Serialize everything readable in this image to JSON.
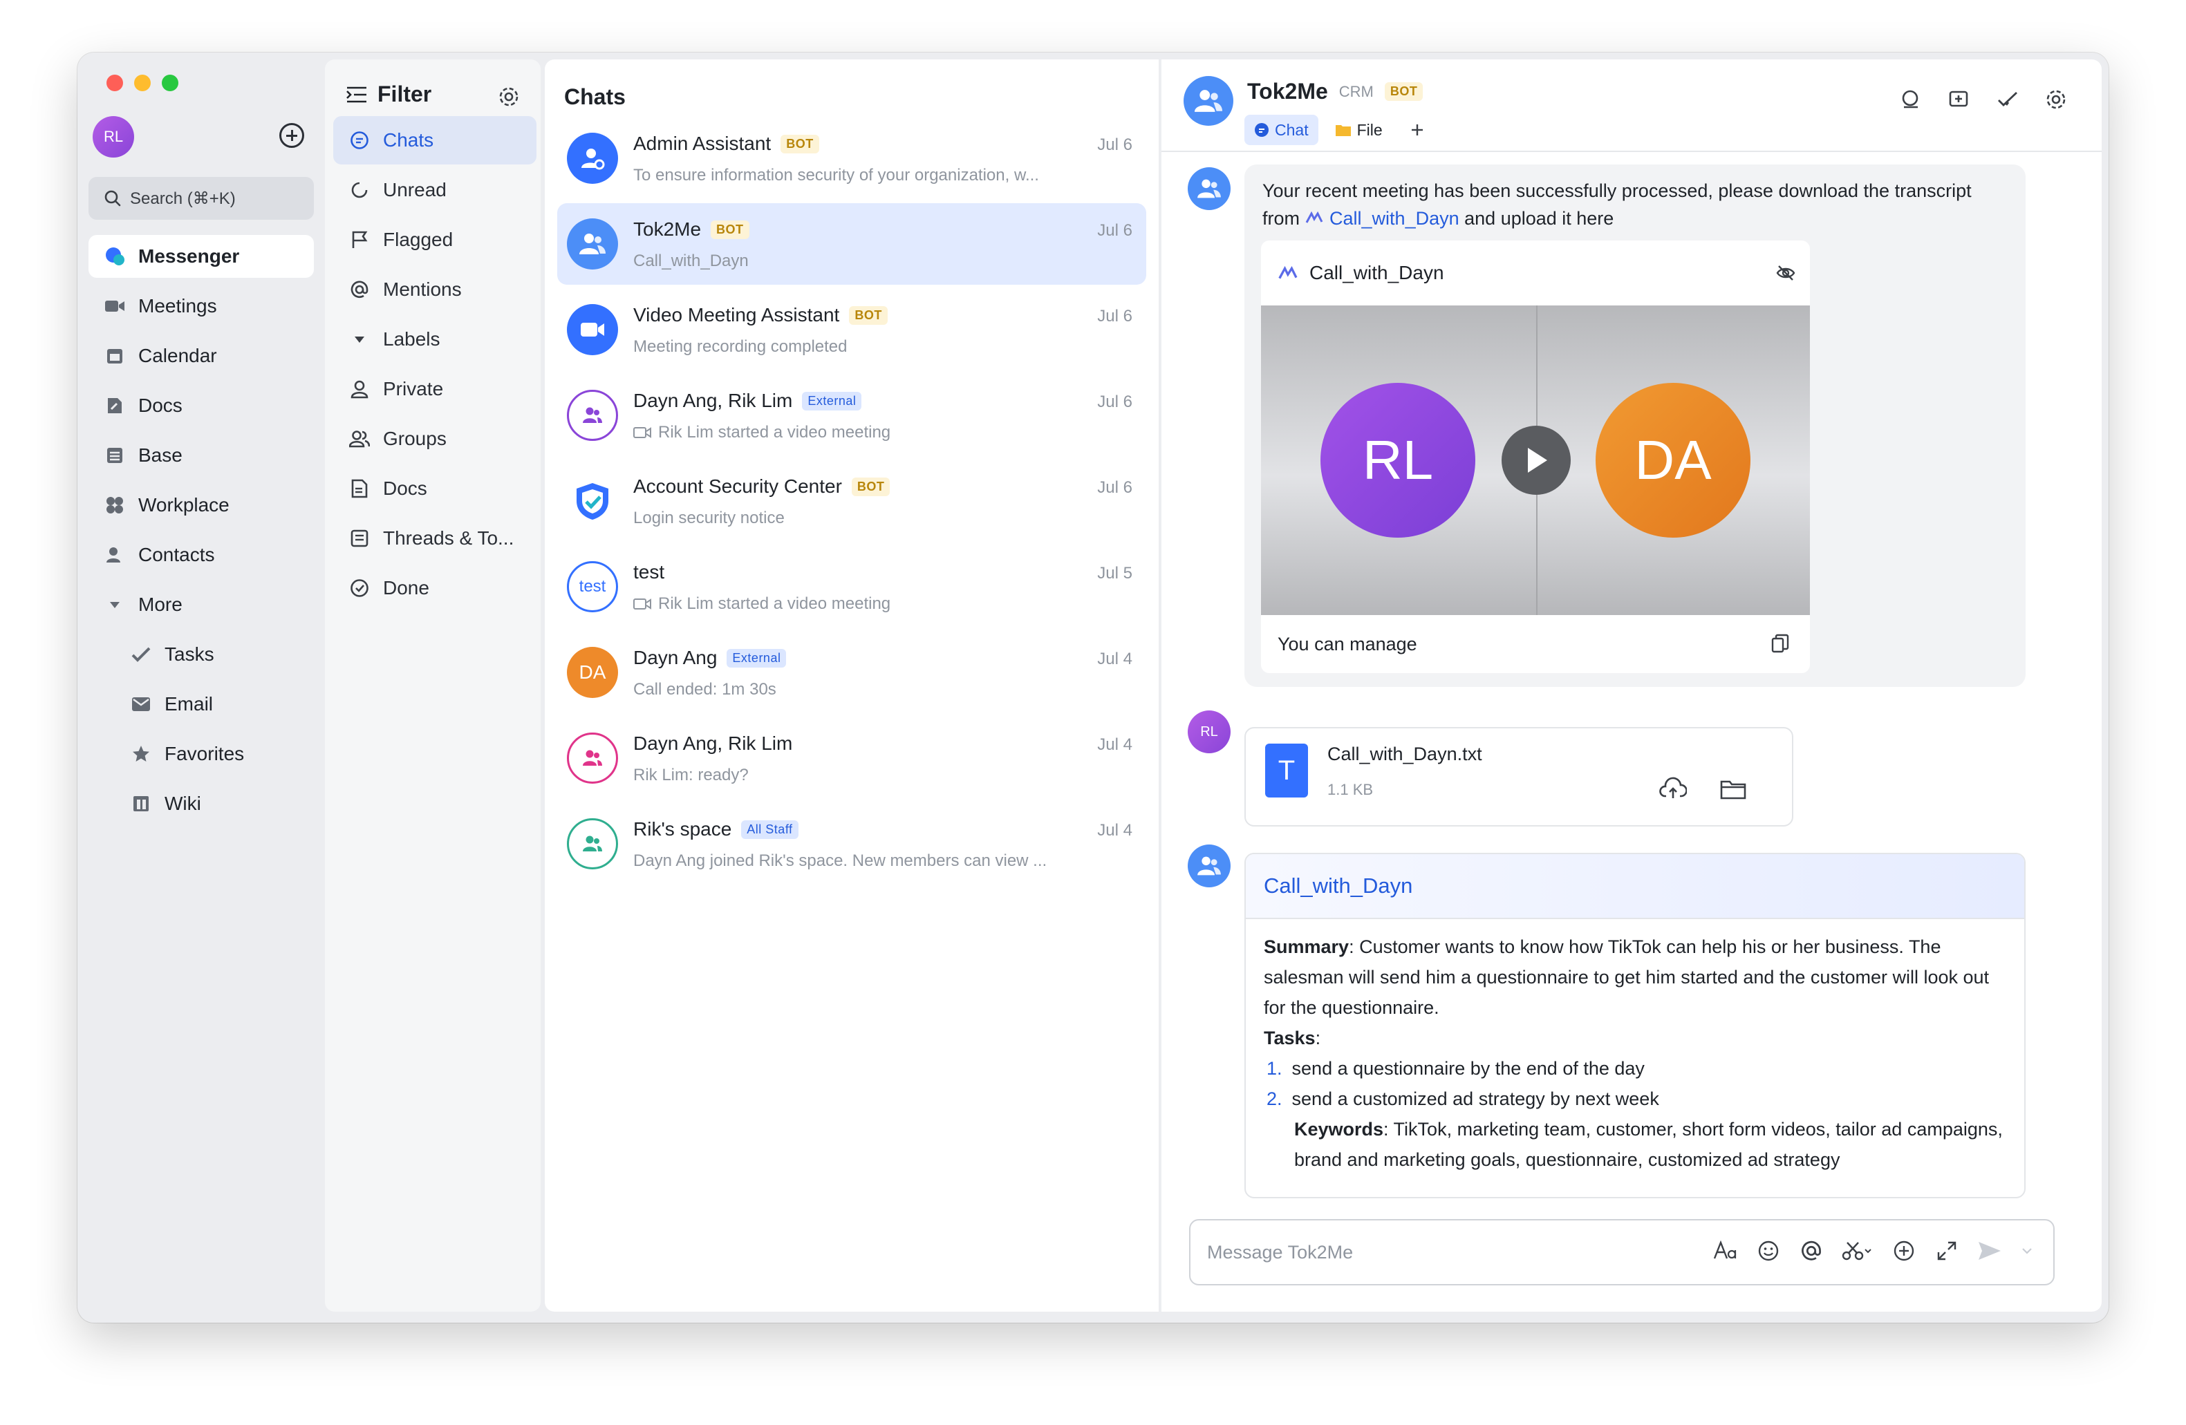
{
  "user": {
    "initials": "RL"
  },
  "search": {
    "placeholder": "Search (⌘+K)"
  },
  "nav": {
    "items": [
      {
        "label": "Messenger"
      },
      {
        "label": "Meetings"
      },
      {
        "label": "Calendar"
      },
      {
        "label": "Docs"
      },
      {
        "label": "Base"
      },
      {
        "label": "Workplace"
      },
      {
        "label": "Contacts"
      },
      {
        "label": "More"
      },
      {
        "label": "Tasks"
      },
      {
        "label": "Email"
      },
      {
        "label": "Favorites"
      },
      {
        "label": "Wiki"
      }
    ]
  },
  "filter": {
    "title": "Filter",
    "items": [
      {
        "label": "Chats"
      },
      {
        "label": "Unread"
      },
      {
        "label": "Flagged"
      },
      {
        "label": "Mentions"
      },
      {
        "label": "Labels"
      },
      {
        "label": "Private"
      },
      {
        "label": "Groups"
      },
      {
        "label": "Docs"
      },
      {
        "label": "Threads & To..."
      },
      {
        "label": "Done"
      }
    ]
  },
  "chats": {
    "title": "Chats",
    "items": [
      {
        "name": "Admin Assistant",
        "tag": "BOT",
        "preview": "To ensure information security of your organization, w...",
        "date": "Jul 6"
      },
      {
        "name": "Tok2Me",
        "tag": "BOT",
        "preview": "Call_with_Dayn",
        "date": "Jul 6"
      },
      {
        "name": "Video Meeting Assistant",
        "tag": "BOT",
        "preview": "Meeting recording completed",
        "date": "Jul 6"
      },
      {
        "name": "Dayn Ang, Rik Lim",
        "tag": "External",
        "preview": "Rik Lim started a video meeting",
        "date": "Jul 6"
      },
      {
        "name": "Account Security Center",
        "tag": "BOT",
        "preview": "Login security notice",
        "date": "Jul 6"
      },
      {
        "name": "test",
        "avatar_text": "test",
        "preview": "Rik Lim started a video meeting",
        "date": "Jul 5"
      },
      {
        "name": "Dayn Ang",
        "tag": "External",
        "avatar_text": "DA",
        "preview": "Call ended: 1m 30s",
        "date": "Jul 4"
      },
      {
        "name": "Dayn Ang, Rik Lim",
        "preview": "Rik Lim: ready?",
        "date": "Jul 4"
      },
      {
        "name": "Rik's space",
        "tag": "All Staff",
        "preview": "Dayn Ang joined Rik's space. New members can view ...",
        "date": "Jul 4"
      }
    ]
  },
  "conversation": {
    "title": "Tok2Me",
    "org": "CRM",
    "tag": "BOT",
    "tabs": [
      "Chat",
      "File"
    ],
    "message1": {
      "text_before": "Your recent meeting has been successfully processed, please download the transcript from",
      "link": "Call_with_Dayn",
      "text_after": "and upload it here",
      "card_title": "Call_with_Dayn",
      "left_initials": "RL",
      "right_initials": "DA",
      "footer": "You can manage"
    },
    "file": {
      "avatar": "RL",
      "icon_letter": "T",
      "name": "Call_with_Dayn.txt",
      "size": "1.1 KB"
    },
    "summary": {
      "title": "Call_with_Dayn",
      "summary_label": "Summary",
      "summary_text": ": Customer wants to know how TikTok can help his or her business. The salesman will send him a questionnaire to get him started and the customer will look out for the questionnaire.",
      "tasks_label": "Tasks",
      "tasks_colon": ":",
      "tasks": [
        {
          "num": "1.",
          "text": "send a questionnaire by the end of the day"
        },
        {
          "num": "2.",
          "text": "send a customized ad strategy by next week"
        }
      ],
      "keywords_label": "Keywords",
      "keywords_text": ": TikTok,  marketing team,  customer,  short form videos,  tailor ad campaigns,  brand and marketing goals,  questionnaire,  customized ad strategy"
    },
    "composer": {
      "placeholder": "Message Tok2Me"
    }
  },
  "colors": {
    "accent": "#245bdb",
    "active_bg": "#e1eaff",
    "bot_tag": "#b8860b"
  }
}
